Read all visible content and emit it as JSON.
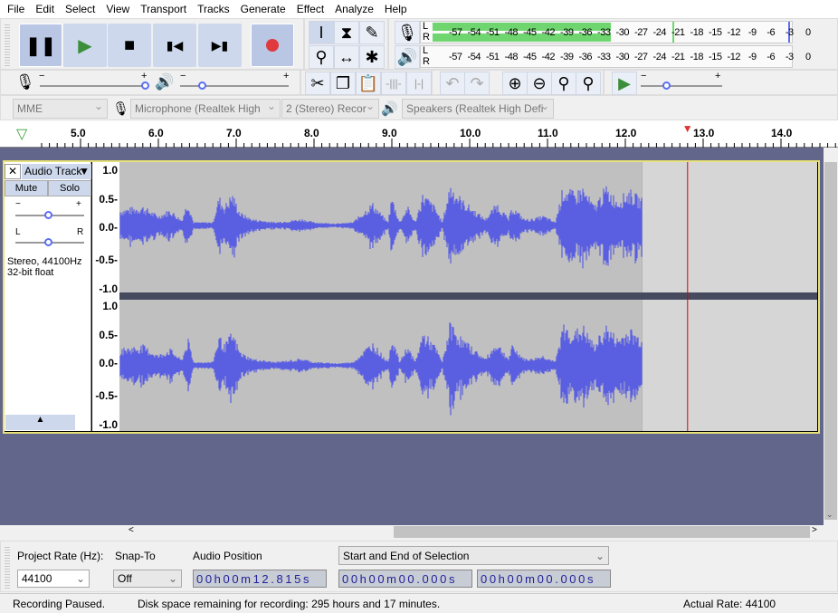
{
  "menu": [
    "File",
    "Edit",
    "Select",
    "View",
    "Transport",
    "Tracks",
    "Generate",
    "Effect",
    "Analyze",
    "Help"
  ],
  "transport": {
    "pause": "pause",
    "play": "play",
    "stop": "stop",
    "skip_start": "skip-to-start",
    "skip_end": "skip-to-end",
    "record": "record",
    "record_color": "#e0393e",
    "play_color": "#3b8f3b"
  },
  "meters": {
    "channels": [
      "L",
      "R"
    ],
    "ticks": [
      "-57",
      "-54",
      "-51",
      "-48",
      "-45",
      "-42",
      "-39",
      "-36",
      "-33",
      "-30",
      "-27",
      "-24",
      "-21",
      "-18",
      "-15",
      "-12",
      "-9",
      "-6",
      "-3",
      "0"
    ],
    "record_level_db": -30,
    "peak_db": -19.5,
    "meter_color": "#6fd66f"
  },
  "mixer": {
    "minus": "−",
    "plus": "+",
    "rec_volume": 1.0,
    "play_volume": 0.2
  },
  "play_at_speed": {
    "minus": "−",
    "plus": "+",
    "speed": 0.35
  },
  "devices": {
    "host": "MME",
    "mic": "Microphone (Realtek High",
    "channels": "2 (Stereo) Recor",
    "speaker": "Speakers (Realtek High Defi"
  },
  "ruler": {
    "ticks": [
      "5.0",
      "6.0",
      "7.0",
      "8.0",
      "9.0",
      "10.0",
      "11.0",
      "12.0",
      "13.0",
      "14.0"
    ],
    "playhead": 12.8
  },
  "track": {
    "name": "Audio Track",
    "mute": "Mute",
    "solo": "Solo",
    "gain_minus": "−",
    "gain_plus": "+",
    "pan_l": "L",
    "pan_r": "R",
    "info1": "Stereo, 44100Hz",
    "info2": "32-bit float",
    "scale": [
      "1.0",
      "0.5-",
      "0.0-",
      "-0.5-",
      "-1.0"
    ],
    "clip_start": 5.51,
    "clip_end": 12.22,
    "waveform_color": "#5a5ee0",
    "envelope": [
      [
        5.51,
        0.25
      ],
      [
        5.8,
        0.3
      ],
      [
        6.0,
        0.15
      ],
      [
        6.15,
        0.25
      ],
      [
        6.3,
        0.08
      ],
      [
        6.38,
        0.4
      ],
      [
        6.45,
        0.05
      ],
      [
        6.7,
        0.05
      ],
      [
        6.78,
        0.45
      ],
      [
        6.85,
        0.3
      ],
      [
        6.95,
        0.5
      ],
      [
        7.05,
        0.2
      ],
      [
        7.2,
        0.1
      ],
      [
        7.5,
        0.05
      ],
      [
        7.85,
        0.1
      ],
      [
        8.0,
        0.05
      ],
      [
        8.3,
        0.03
      ],
      [
        8.5,
        0.05
      ],
      [
        8.75,
        0.35
      ],
      [
        8.85,
        0.2
      ],
      [
        8.95,
        0.05
      ],
      [
        9.0,
        0.45
      ],
      [
        9.1,
        0.05
      ],
      [
        9.2,
        0.3
      ],
      [
        9.3,
        0.05
      ],
      [
        9.4,
        0.5
      ],
      [
        9.55,
        0.3
      ],
      [
        9.65,
        0.05
      ],
      [
        9.75,
        0.65
      ],
      [
        9.9,
        0.4
      ],
      [
        10.0,
        0.3
      ],
      [
        10.2,
        0.1
      ],
      [
        10.35,
        0.35
      ],
      [
        10.5,
        0.1
      ],
      [
        10.55,
        0.3
      ],
      [
        10.7,
        0.1
      ],
      [
        10.8,
        0.1
      ],
      [
        10.95,
        0.15
      ],
      [
        11.1,
        0.05
      ],
      [
        11.2,
        0.6
      ],
      [
        11.35,
        0.5
      ],
      [
        11.45,
        0.6
      ],
      [
        11.6,
        0.3
      ],
      [
        11.75,
        0.6
      ],
      [
        11.9,
        0.4
      ],
      [
        12.05,
        0.55
      ],
      [
        12.22,
        0.4
      ]
    ]
  },
  "selection": {
    "rate_label": "Project Rate (Hz):",
    "rate": "44100",
    "snap_label": "Snap-To",
    "snap": "Off",
    "pos_label": "Audio Position",
    "pos": "00h00m12.815s",
    "sel_mode": "Start and End of Selection",
    "start": "00h00m00.000s",
    "end": "00h00m00.000s"
  },
  "status": {
    "state": "Recording Paused.",
    "disk": "Disk space remaining for recording: 295 hours and 17 minutes.",
    "rate": "Actual Rate: 44100"
  }
}
